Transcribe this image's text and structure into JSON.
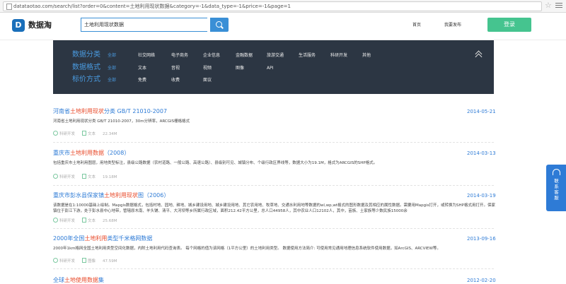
{
  "browser": {
    "url": "datataotao.com/search/list?order=0&content=土地利用现状数据&category=-1&data_type=-1&price=-1&page=1"
  },
  "header": {
    "logo_mark": "D",
    "logo_text": "数据淘",
    "search_value": "土地利用现状数据",
    "nav_home": "首页",
    "nav_publish": "我要发布",
    "login_label": "登录"
  },
  "filters": {
    "category": {
      "title": "数据分类",
      "options": [
        "全部",
        "社交网络",
        "电子商务",
        "企业信息",
        "金融数据",
        "旅游交通",
        "生活服务",
        "科研开发",
        "其他"
      ]
    },
    "format": {
      "title": "数据格式",
      "options": [
        "全部",
        "文本",
        "音视",
        "视频",
        "图像",
        "API"
      ]
    },
    "price": {
      "title": "标价方式",
      "options": [
        "全部",
        "免费",
        "收费",
        "面议"
      ]
    }
  },
  "results": [
    {
      "title_before": "河南省",
      "title_hl": "土地利用现状",
      "title_after": "分类 GB/T 21010-2007",
      "date": "2014-05-21",
      "desc": "河南省土地利用现状分类 GB/T 21010-2007，30m分辨率，ARCGIS栅格格式",
      "category": "科研开发",
      "type": "文本",
      "size": "22.34M"
    },
    {
      "title_before": "重庆市",
      "title_hl": "土地利用数据",
      "title_after": "（2008）",
      "date": "2014-03-13",
      "desc": "包括重庆市土地利用图层，用地类型标注，县级公路数据（农村道路、一般公路、高速公路）、县级别可见、城镇分布、个级行政区界线等，数据大小为19.1M，格式为ARCGIS的SHP格式。",
      "category": "科研开发",
      "type": "文本",
      "size": "19.18M"
    },
    {
      "title_before": "重庆市彭水县保家镇",
      "title_hl": "土地利用现状",
      "title_after": "图（2006）",
      "date": "2014-03-19",
      "desc": "该数据是在1:10000基础上绘制。Mapgis数据格式，包括村地、园地、耕地、城乡建设用地、城乡建设用地、其它农用地、牧草地、交通水利用地等数据的wl,wp,wt格式的图形数据及其相应的属性数据。需要用Mapgis打开，或转换为SHP格式用打开。保家镇位于彭江下游，处于彭水县中心地带，管辖原木南、羊头铺、清平、大河坝等乡所属行政区域，面积212.42平方公里，总人口44958人，其中农业人口12102人，其中，苗族、土家族等少数民族15000余",
      "category": "科研开发",
      "type": "文本",
      "size": "25.68M"
    },
    {
      "title_before": "2000年全国",
      "title_hl": "土地利用",
      "title_after": "类型千米格网数据",
      "date": "2013-09-16",
      "desc": "2000年1km格网全国土地利用类型空间化数据，内附土地利用代码查询表。 每个网格的值为该网格（1平方公里）的土地利用类型。 数据使用方法简介: 可使用常见通用地理信息系统软件使用数据，如ArcGIS、ARCVIEW等。",
      "category": "科研开发",
      "type": "图像",
      "size": "47.59M"
    },
    {
      "title_before": "全球",
      "title_hl": "土地使用数据",
      "title_after": "集",
      "date": "2012-02-20",
      "desc": "",
      "category": "",
      "type": "",
      "size": ""
    }
  ],
  "contact": {
    "label": "联系客服"
  },
  "colors": {
    "brand_blue": "#2e7bd6",
    "highlight_red": "#e84a2a",
    "login_green": "#45c48f",
    "panel_bg": "#2c3643"
  }
}
